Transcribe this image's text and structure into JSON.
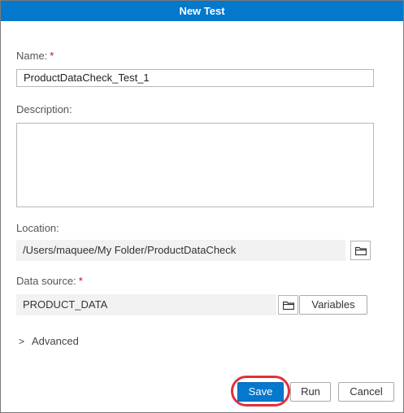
{
  "dialog": {
    "title": "New Test"
  },
  "form": {
    "name_label": "Name:",
    "required_mark": "*",
    "name_value": "ProductDataCheck_Test_1",
    "description_label": "Description:",
    "description_value": "",
    "location_label": "Location:",
    "location_value": "/Users/maquee/My Folder/ProductDataCheck",
    "data_source_label": "Data source:",
    "data_source_value": "PRODUCT_DATA",
    "variables_label": "Variables",
    "advanced_label": "Advanced",
    "advanced_chevron": ">"
  },
  "footer": {
    "save_label": "Save",
    "run_label": "Run",
    "cancel_label": "Cancel"
  },
  "icons": {
    "folder": "folder-icon",
    "chevron": "chevron-right-icon"
  },
  "colors": {
    "accent": "#0378cd",
    "required": "#d0011b",
    "highlight_ring": "#e0303a"
  }
}
